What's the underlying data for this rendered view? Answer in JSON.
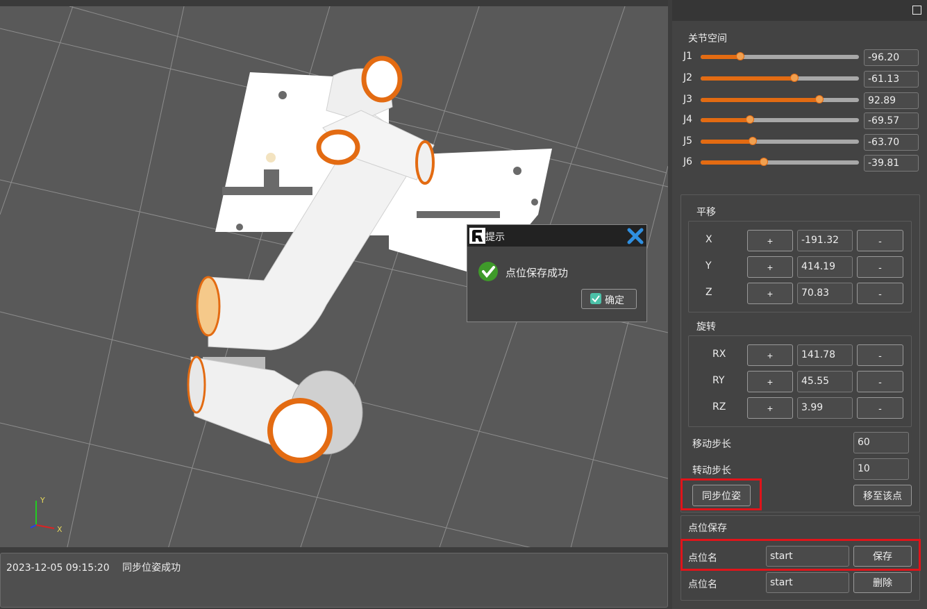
{
  "log": {
    "timestamp": "2023-12-05 09:15:20",
    "message": "同步位姿成功"
  },
  "viewport": {
    "axis_y": "Y",
    "axis_x": "X"
  },
  "joint_space": {
    "title": "关节空间",
    "joints": [
      {
        "label": "J1",
        "value": "-96.20",
        "level": 0.25
      },
      {
        "label": "J2",
        "value": "-61.13",
        "level": 0.59
      },
      {
        "label": "J3",
        "value": "92.89",
        "level": 0.75
      },
      {
        "label": "J4",
        "value": "-69.57",
        "level": 0.31
      },
      {
        "label": "J5",
        "value": "-63.70",
        "level": 0.33
      },
      {
        "label": "J6",
        "value": "-39.81",
        "level": 0.4
      }
    ]
  },
  "translation": {
    "title": "平移",
    "rows": [
      {
        "axis": "X",
        "plus": "+",
        "value": "-191.32",
        "minus": "-"
      },
      {
        "axis": "Y",
        "plus": "+",
        "value": "414.19",
        "minus": "-"
      },
      {
        "axis": "Z",
        "plus": "+",
        "value": "70.83",
        "minus": "-"
      }
    ]
  },
  "rotation": {
    "title": "旋转",
    "rows": [
      {
        "axis": "RX",
        "plus": "+",
        "value": "141.78",
        "minus": "-"
      },
      {
        "axis": "RY",
        "plus": "+",
        "value": "45.55",
        "minus": "-"
      },
      {
        "axis": "RZ",
        "plus": "+",
        "value": "3.99",
        "minus": "-"
      }
    ]
  },
  "steps": {
    "move_label": "移动步长",
    "move_value": "60",
    "rotate_label": "转动步长",
    "rotate_value": "10"
  },
  "actions": {
    "sync_pose": "同步位姿",
    "move_to_point": "移至该点"
  },
  "point_save": {
    "title": "点位保存",
    "save_label": "点位名",
    "save_value": "start",
    "save_button": "保存",
    "delete_label": "点位名",
    "delete_value": "start",
    "delete_button": "删除"
  },
  "dialog": {
    "title": "提示",
    "message": "点位保存成功",
    "ok": "确定"
  },
  "colors": {
    "accent": "#e36b12",
    "highlight": "#e0141a",
    "viewport_bg": "#595959"
  }
}
